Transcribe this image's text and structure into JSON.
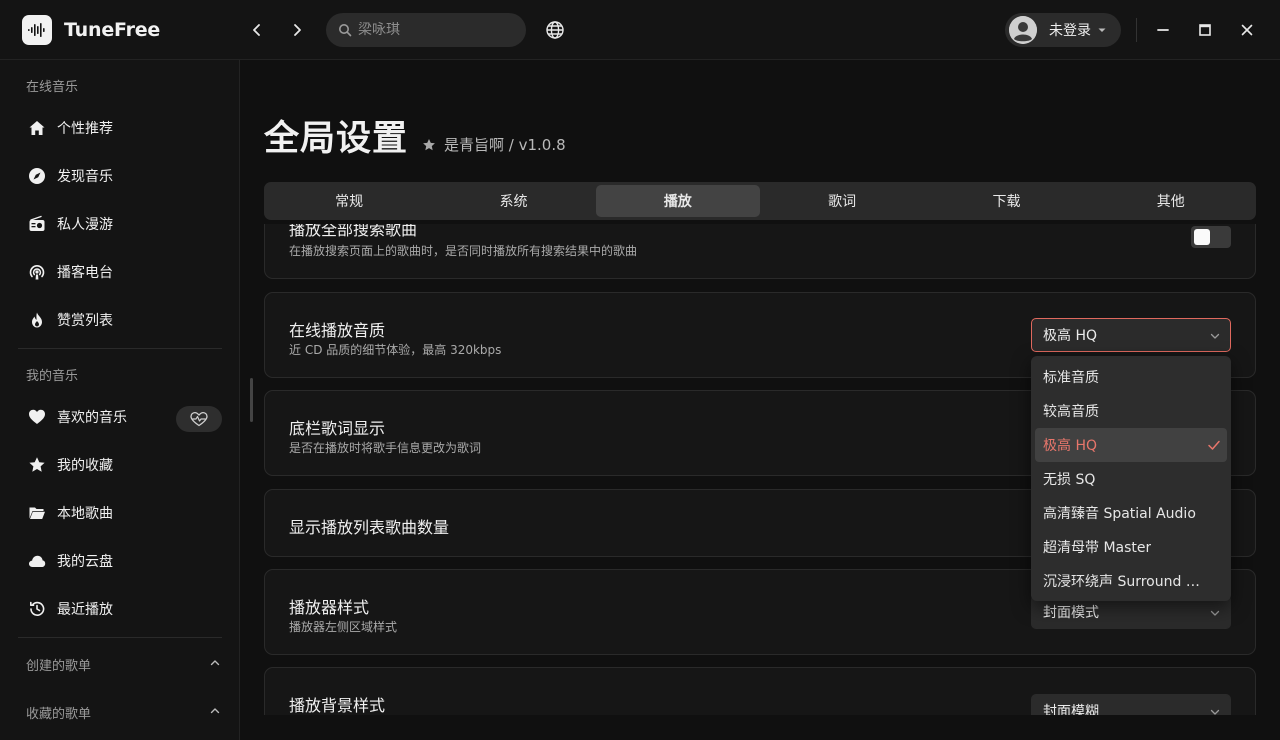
{
  "app": {
    "name": "TuneFree",
    "search_placeholder": "梁咏琪",
    "user_name": "未登录"
  },
  "sidebar": {
    "section_online": "在线音乐",
    "online_items": [
      {
        "label": "个性推荐",
        "icon": "home-icon"
      },
      {
        "label": "发现音乐",
        "icon": "compass-icon"
      },
      {
        "label": "私人漫游",
        "icon": "radio-icon"
      },
      {
        "label": "播客电台",
        "icon": "podcast-icon"
      },
      {
        "label": "赞赏列表",
        "icon": "fire-icon"
      }
    ],
    "section_mine": "我的音乐",
    "mine_items": [
      {
        "label": "喜欢的音乐",
        "icon": "heart-icon"
      },
      {
        "label": "我的收藏",
        "icon": "star-icon"
      },
      {
        "label": "本地歌曲",
        "icon": "folder-icon"
      },
      {
        "label": "我的云盘",
        "icon": "cloud-icon"
      },
      {
        "label": "最近播放",
        "icon": "history-icon"
      }
    ],
    "created_playlists": "创建的歌单",
    "collected_playlists": "收藏的歌单"
  },
  "page": {
    "title": "全局设置",
    "subtitle": "是青旨啊 / v1.0.8",
    "tabs": [
      "常规",
      "系统",
      "播放",
      "歌词",
      "下载",
      "其他"
    ],
    "active_tab": "播放"
  },
  "settings": {
    "play_all_search": {
      "title": "播放全部搜索歌曲",
      "desc": "在播放搜索页面上的歌曲时，是否同时播放所有搜索结果中的歌曲",
      "enabled": false
    },
    "online_quality": {
      "title": "在线播放音质",
      "desc": "近 CD 品质的细节体验，最高 320kbps",
      "value": "极高 HQ",
      "options": [
        "标准音质",
        "较高音质",
        "极高 HQ",
        "无损 SQ",
        "高清臻音 Spatial Audio",
        "超清母带 Master",
        "沉浸环绕声 Surround Audio"
      ],
      "selected_index": 2
    },
    "bottom_lyric": {
      "title": "底栏歌词显示",
      "desc": "是否在播放时将歌手信息更改为歌词"
    },
    "show_count": {
      "title": "显示播放列表歌曲数量"
    },
    "player_style": {
      "title": "播放器样式",
      "desc": "播放器左侧区域样式",
      "value": "封面模式"
    },
    "player_bg": {
      "title": "播放背景样式",
      "value": "封面模糊"
    }
  },
  "colors": {
    "accent": "#e8766b",
    "focus_border": "#e0695e",
    "background": "#101010",
    "panel": "#161616"
  }
}
